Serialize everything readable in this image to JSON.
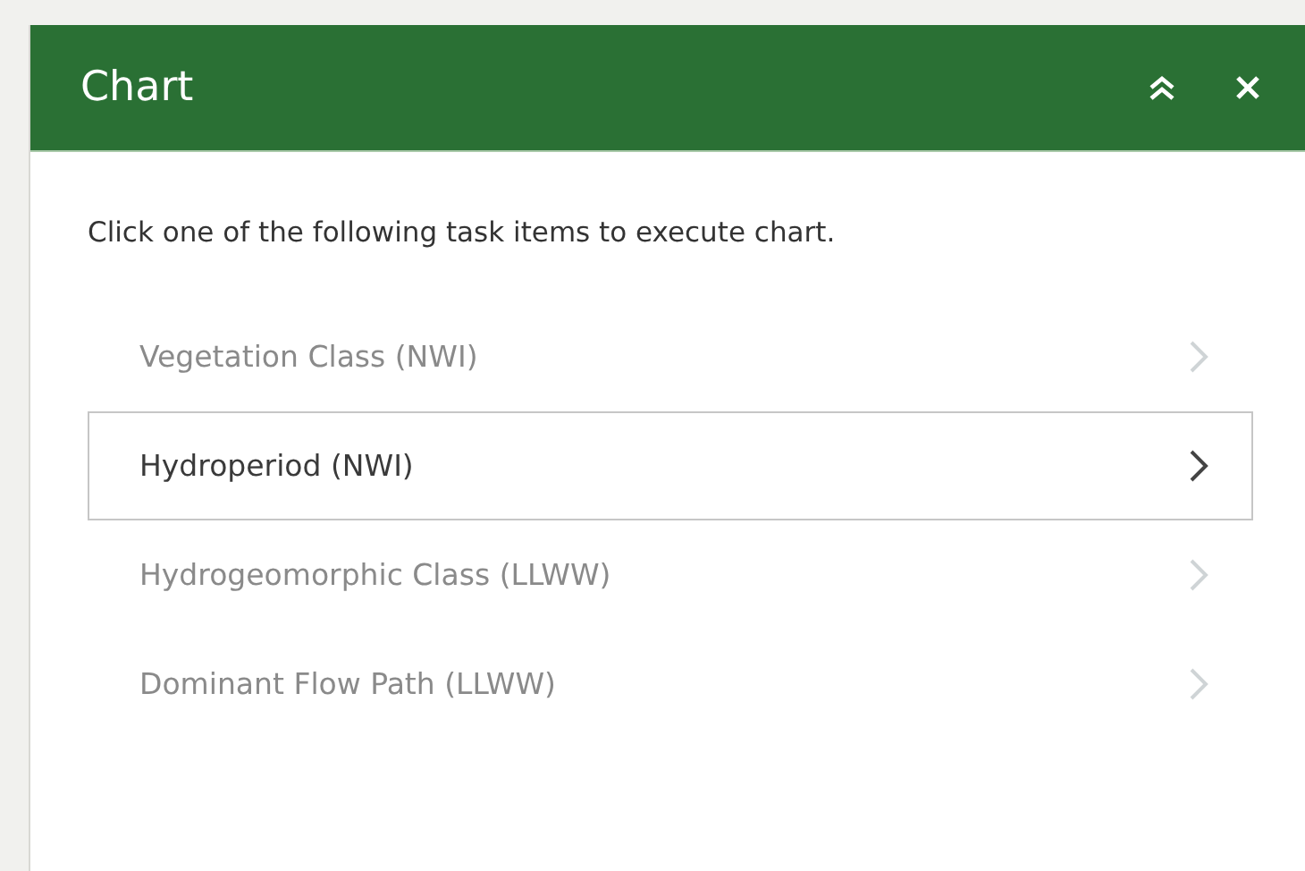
{
  "panel": {
    "title": "Chart",
    "instruction": "Click one of the following task items to execute chart.",
    "items": [
      {
        "label": "Vegetation Class (NWI)",
        "selected": false
      },
      {
        "label": "Hydroperiod (NWI)",
        "selected": true
      },
      {
        "label": "Hydrogeomorphic Class (LLWW)",
        "selected": false
      },
      {
        "label": "Dominant Flow Path (LLWW)",
        "selected": false
      }
    ]
  }
}
